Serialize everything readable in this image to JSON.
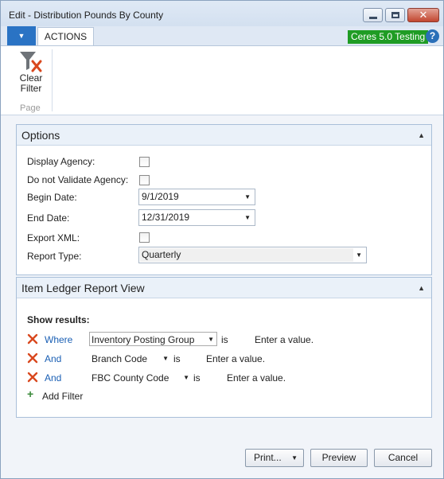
{
  "window": {
    "title": "Edit - Distribution Pounds By County",
    "close_glyph": "✕"
  },
  "ribbon": {
    "app_menu_glyph": "▼",
    "tab_label": "ACTIONS",
    "environment_badge": "Ceres 5.0 Testing",
    "help_glyph": "?",
    "clear_filter_line1": "Clear",
    "clear_filter_line2": "Filter",
    "group_label": "Page"
  },
  "options": {
    "header": "Options",
    "collapse_glyph": "▲",
    "display_agency_label": "Display Agency:",
    "do_not_validate_label": "Do not Validate Agency:",
    "begin_date_label": "Begin Date:",
    "begin_date_value": "9/1/2019",
    "end_date_label": "End Date:",
    "end_date_value": "12/31/2019",
    "export_xml_label": "Export XML:",
    "report_type_label": "Report Type:",
    "report_type_value": "Quarterly",
    "dropdown_glyph": "▼",
    "display_agency_checked": false,
    "do_not_validate_checked": false,
    "export_xml_checked": false
  },
  "item_ledger": {
    "header": "Item Ledger Report View",
    "collapse_glyph": "▲",
    "show_results": "Show results:",
    "filters": [
      {
        "conjunction": "Where",
        "field": "Inventory Posting Group",
        "operator": "is",
        "value_placeholder": "Enter a value."
      },
      {
        "conjunction": "And",
        "field": "Branch Code",
        "operator": "is",
        "value_placeholder": "Enter a value."
      },
      {
        "conjunction": "And",
        "field": "FBC County Code",
        "operator": "is",
        "value_placeholder": "Enter a value."
      }
    ],
    "add_filter_glyph": "+",
    "add_filter": "Add Filter"
  },
  "footer": {
    "print_label": "Print...",
    "preview_label": "Preview",
    "cancel_label": "Cancel"
  },
  "colors": {
    "accent": "#2a73c4",
    "badge_green": "#1f9c24",
    "link_blue": "#1a5fb4",
    "remove_red": "#d9481e"
  }
}
